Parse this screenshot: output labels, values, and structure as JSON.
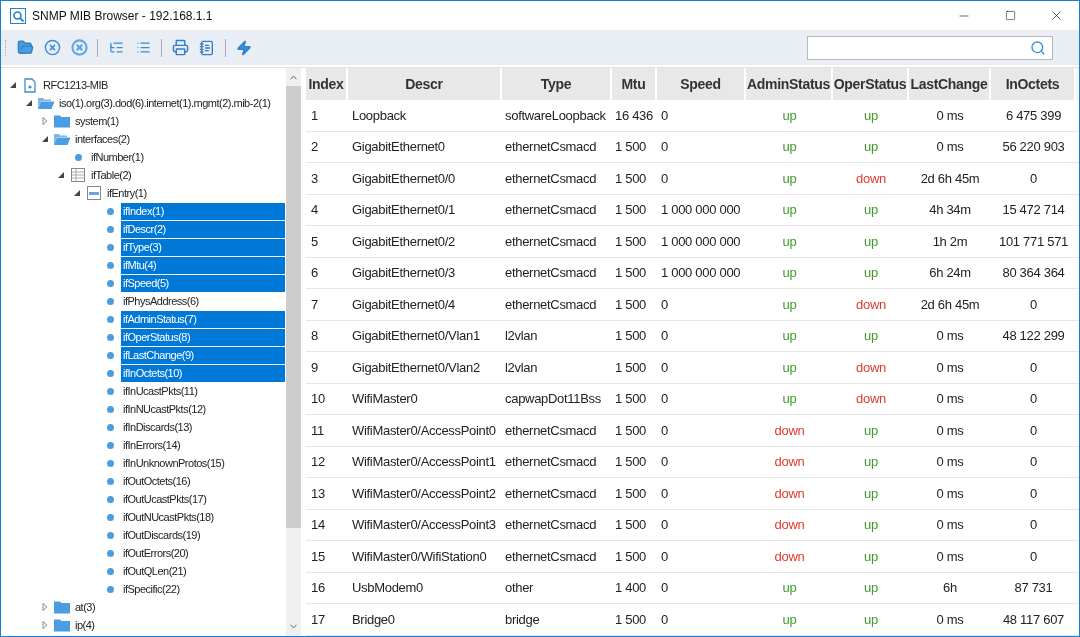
{
  "window": {
    "title": "SNMP MIB Browser - 192.168.1.1"
  },
  "tree": [
    {
      "label": "RFC1213-MIB",
      "kind": "module",
      "expanded": true,
      "selected": false,
      "children": [
        {
          "label": "iso(1).org(3).dod(6).internet(1).mgmt(2).mib-2(1)",
          "kind": "folder",
          "expanded": true,
          "selected": false,
          "children": [
            {
              "label": "system(1)",
              "kind": "folder",
              "expanded": false,
              "selected": false
            },
            {
              "label": "interfaces(2)",
              "kind": "folder",
              "expanded": true,
              "selected": false,
              "children": [
                {
                  "label": "ifNumber(1)",
                  "kind": "leaf",
                  "selected": false
                },
                {
                  "label": "ifTable(2)",
                  "kind": "table",
                  "expanded": true,
                  "selected": false,
                  "children": [
                    {
                      "label": "ifEntry(1)",
                      "kind": "entry",
                      "expanded": true,
                      "selected": false,
                      "children": [
                        {
                          "label": "ifIndex(1)",
                          "kind": "leaf",
                          "selected": true
                        },
                        {
                          "label": "ifDescr(2)",
                          "kind": "leaf",
                          "selected": true
                        },
                        {
                          "label": "ifType(3)",
                          "kind": "leaf",
                          "selected": true
                        },
                        {
                          "label": "ifMtu(4)",
                          "kind": "leaf",
                          "selected": true
                        },
                        {
                          "label": "ifSpeed(5)",
                          "kind": "leaf",
                          "selected": true
                        },
                        {
                          "label": "ifPhysAddress(6)",
                          "kind": "leaf",
                          "selected": false
                        },
                        {
                          "label": "ifAdminStatus(7)",
                          "kind": "leaf",
                          "selected": true
                        },
                        {
                          "label": "ifOperStatus(8)",
                          "kind": "leaf",
                          "selected": true
                        },
                        {
                          "label": "ifLastChange(9)",
                          "kind": "leaf",
                          "selected": true
                        },
                        {
                          "label": "ifInOctets(10)",
                          "kind": "leaf",
                          "selected": true
                        },
                        {
                          "label": "ifInUcastPkts(11)",
                          "kind": "leaf",
                          "selected": false
                        },
                        {
                          "label": "ifInNUcastPkts(12)",
                          "kind": "leaf",
                          "selected": false
                        },
                        {
                          "label": "ifInDiscards(13)",
                          "kind": "leaf",
                          "selected": false
                        },
                        {
                          "label": "ifInErrors(14)",
                          "kind": "leaf",
                          "selected": false
                        },
                        {
                          "label": "ifInUnknownProtos(15)",
                          "kind": "leaf",
                          "selected": false
                        },
                        {
                          "label": "ifOutOctets(16)",
                          "kind": "leaf",
                          "selected": false
                        },
                        {
                          "label": "ifOutUcastPkts(17)",
                          "kind": "leaf",
                          "selected": false
                        },
                        {
                          "label": "ifOutNUcastPkts(18)",
                          "kind": "leaf",
                          "selected": false
                        },
                        {
                          "label": "ifOutDiscards(19)",
                          "kind": "leaf",
                          "selected": false
                        },
                        {
                          "label": "ifOutErrors(20)",
                          "kind": "leaf",
                          "selected": false
                        },
                        {
                          "label": "ifOutQLen(21)",
                          "kind": "leaf",
                          "selected": false
                        },
                        {
                          "label": "ifSpecific(22)",
                          "kind": "leaf",
                          "selected": false
                        }
                      ]
                    }
                  ]
                }
              ]
            },
            {
              "label": "at(3)",
              "kind": "folder",
              "expanded": false,
              "selected": false
            },
            {
              "label": "ip(4)",
              "kind": "folder",
              "expanded": false,
              "selected": false
            }
          ]
        }
      ]
    }
  ],
  "table": {
    "columns": [
      "Index",
      "Descr",
      "Type",
      "Mtu",
      "Speed",
      "AdminStatus",
      "OperStatus",
      "LastChange",
      "InOctets"
    ],
    "rows": [
      {
        "index": "1",
        "descr": "Loopback",
        "type": "softwareLoopback",
        "mtu": "16 436",
        "speed": "0",
        "admin_status": {
          "text": "up",
          "color": "#3f9c28"
        },
        "oper_status": {
          "text": "up",
          "color": "#3f9c28"
        },
        "last_change": "0 ms",
        "in_octets": "6 475 399"
      },
      {
        "index": "2",
        "descr": "GigabitEthernet0",
        "type": "ethernetCsmacd",
        "mtu": "1 500",
        "speed": "0",
        "admin_status": {
          "text": "up",
          "color": "#3f9c28"
        },
        "oper_status": {
          "text": "up",
          "color": "#3f9c28"
        },
        "last_change": "0 ms",
        "in_octets": "56 220 903"
      },
      {
        "index": "3",
        "descr": "GigabitEthernet0/0",
        "type": "ethernetCsmacd",
        "mtu": "1 500",
        "speed": "0",
        "admin_status": {
          "text": "up",
          "color": "#3f9c28"
        },
        "oper_status": {
          "text": "down",
          "color": "#e03a2c"
        },
        "last_change": "2d 6h 45m",
        "in_octets": "0"
      },
      {
        "index": "4",
        "descr": "GigabitEthernet0/1",
        "type": "ethernetCsmacd",
        "mtu": "1 500",
        "speed": "1 000 000 000",
        "admin_status": {
          "text": "up",
          "color": "#3f9c28"
        },
        "oper_status": {
          "text": "up",
          "color": "#3f9c28"
        },
        "last_change": "4h 34m",
        "in_octets": "15 472 714"
      },
      {
        "index": "5",
        "descr": "GigabitEthernet0/2",
        "type": "ethernetCsmacd",
        "mtu": "1 500",
        "speed": "1 000 000 000",
        "admin_status": {
          "text": "up",
          "color": "#3f9c28"
        },
        "oper_status": {
          "text": "up",
          "color": "#3f9c28"
        },
        "last_change": "1h 2m",
        "in_octets": "101 771 571"
      },
      {
        "index": "6",
        "descr": "GigabitEthernet0/3",
        "type": "ethernetCsmacd",
        "mtu": "1 500",
        "speed": "1 000 000 000",
        "admin_status": {
          "text": "up",
          "color": "#3f9c28"
        },
        "oper_status": {
          "text": "up",
          "color": "#3f9c28"
        },
        "last_change": "6h 24m",
        "in_octets": "80 364 364"
      },
      {
        "index": "7",
        "descr": "GigabitEthernet0/4",
        "type": "ethernetCsmacd",
        "mtu": "1 500",
        "speed": "0",
        "admin_status": {
          "text": "up",
          "color": "#3f9c28"
        },
        "oper_status": {
          "text": "down",
          "color": "#e03a2c"
        },
        "last_change": "2d 6h 45m",
        "in_octets": "0"
      },
      {
        "index": "8",
        "descr": "GigabitEthernet0/Vlan1",
        "type": "l2vlan",
        "mtu": "1 500",
        "speed": "0",
        "admin_status": {
          "text": "up",
          "color": "#3f9c28"
        },
        "oper_status": {
          "text": "up",
          "color": "#3f9c28"
        },
        "last_change": "0 ms",
        "in_octets": "48 122 299"
      },
      {
        "index": "9",
        "descr": "GigabitEthernet0/Vlan2",
        "type": "l2vlan",
        "mtu": "1 500",
        "speed": "0",
        "admin_status": {
          "text": "up",
          "color": "#3f9c28"
        },
        "oper_status": {
          "text": "down",
          "color": "#e03a2c"
        },
        "last_change": "0 ms",
        "in_octets": "0"
      },
      {
        "index": "10",
        "descr": "WifiMaster0",
        "type": "capwapDot11Bss",
        "mtu": "1 500",
        "speed": "0",
        "admin_status": {
          "text": "up",
          "color": "#3f9c28"
        },
        "oper_status": {
          "text": "down",
          "color": "#e03a2c"
        },
        "last_change": "0 ms",
        "in_octets": "0"
      },
      {
        "index": "11",
        "descr": "WifiMaster0/AccessPoint0",
        "type": "ethernetCsmacd",
        "mtu": "1 500",
        "speed": "0",
        "admin_status": {
          "text": "down",
          "color": "#e03a2c"
        },
        "oper_status": {
          "text": "up",
          "color": "#3f9c28"
        },
        "last_change": "0 ms",
        "in_octets": "0"
      },
      {
        "index": "12",
        "descr": "WifiMaster0/AccessPoint1",
        "type": "ethernetCsmacd",
        "mtu": "1 500",
        "speed": "0",
        "admin_status": {
          "text": "down",
          "color": "#e03a2c"
        },
        "oper_status": {
          "text": "up",
          "color": "#3f9c28"
        },
        "last_change": "0 ms",
        "in_octets": "0"
      },
      {
        "index": "13",
        "descr": "WifiMaster0/AccessPoint2",
        "type": "ethernetCsmacd",
        "mtu": "1 500",
        "speed": "0",
        "admin_status": {
          "text": "down",
          "color": "#e03a2c"
        },
        "oper_status": {
          "text": "up",
          "color": "#3f9c28"
        },
        "last_change": "0 ms",
        "in_octets": "0"
      },
      {
        "index": "14",
        "descr": "WifiMaster0/AccessPoint3",
        "type": "ethernetCsmacd",
        "mtu": "1 500",
        "speed": "0",
        "admin_status": {
          "text": "down",
          "color": "#e03a2c"
        },
        "oper_status": {
          "text": "up",
          "color": "#3f9c28"
        },
        "last_change": "0 ms",
        "in_octets": "0"
      },
      {
        "index": "15",
        "descr": "WifiMaster0/WifiStation0",
        "type": "ethernetCsmacd",
        "mtu": "1 500",
        "speed": "0",
        "admin_status": {
          "text": "down",
          "color": "#e03a2c"
        },
        "oper_status": {
          "text": "up",
          "color": "#3f9c28"
        },
        "last_change": "0 ms",
        "in_octets": "0"
      },
      {
        "index": "16",
        "descr": "UsbModem0",
        "type": "other",
        "mtu": "1 400",
        "speed": "0",
        "admin_status": {
          "text": "up",
          "color": "#3f9c28"
        },
        "oper_status": {
          "text": "up",
          "color": "#3f9c28"
        },
        "last_change": "6h",
        "in_octets": "87 731"
      },
      {
        "index": "17",
        "descr": "Bridge0",
        "type": "bridge",
        "mtu": "1 500",
        "speed": "0",
        "admin_status": {
          "text": "up",
          "color": "#3f9c28"
        },
        "oper_status": {
          "text": "up",
          "color": "#3f9c28"
        },
        "last_change": "0 ms",
        "in_octets": "48 117 607"
      }
    ]
  }
}
